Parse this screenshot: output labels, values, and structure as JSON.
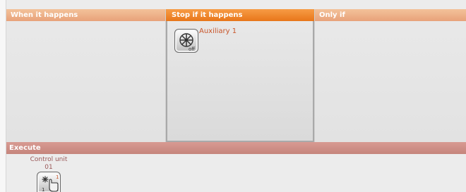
{
  "panels": {
    "when": {
      "title": "When it happens"
    },
    "stop": {
      "title": "Stop if it happens",
      "item_label": "Auxiliary 1",
      "item_icon": "fan-off-icon",
      "item_badge": "off"
    },
    "only": {
      "title": "Only if"
    }
  },
  "execute": {
    "title": "Execute",
    "item_name": "Control unit",
    "item_number": "01",
    "item_icon": "hand-touch-icon",
    "item_badge_left": "1",
    "item_badge_right": "1"
  },
  "colors": {
    "stop_header": "#e8761a",
    "panel_header": "#e8a27a",
    "execute_header": "#c5857c",
    "item_label": "#c8552a"
  }
}
